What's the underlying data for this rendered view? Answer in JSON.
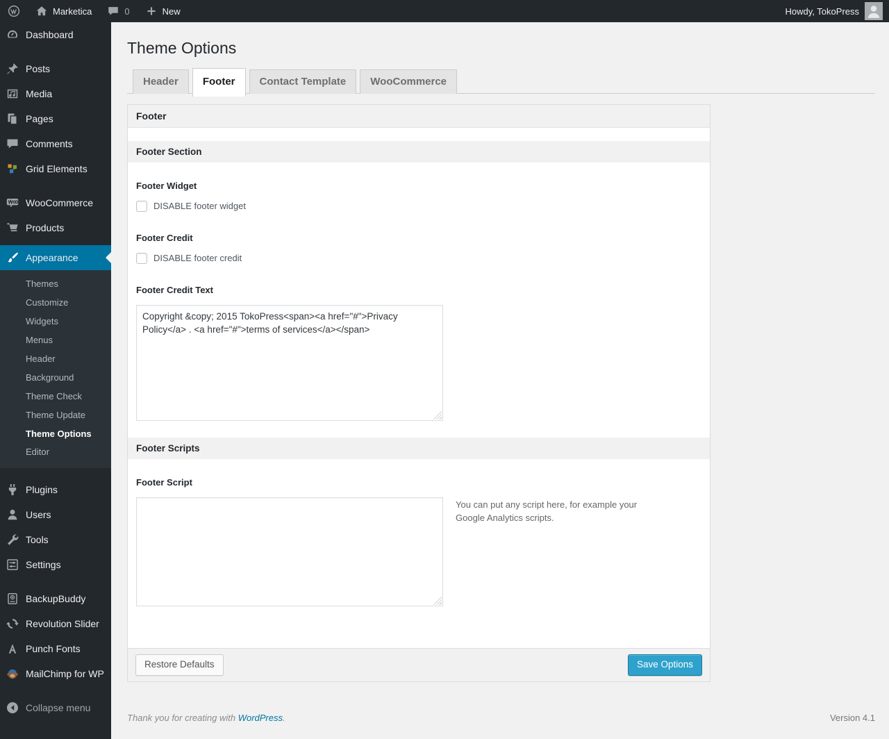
{
  "admin_bar": {
    "site_name": "Marketica",
    "comments_count": "0",
    "new_label": "New",
    "howdy": "Howdy, TokoPress"
  },
  "sidebar": {
    "dashboard": "Dashboard",
    "posts": "Posts",
    "media": "Media",
    "pages": "Pages",
    "comments": "Comments",
    "grid_elements": "Grid Elements",
    "woocommerce": "WooCommerce",
    "products": "Products",
    "appearance": "Appearance",
    "appearance_submenu": [
      "Themes",
      "Customize",
      "Widgets",
      "Menus",
      "Header",
      "Background",
      "Theme Check",
      "Theme Update",
      "Theme Options",
      "Editor"
    ],
    "plugins": "Plugins",
    "users": "Users",
    "tools": "Tools",
    "settings": "Settings",
    "backupbuddy": "BackupBuddy",
    "revolution_slider": "Revolution Slider",
    "punch_fonts": "Punch Fonts",
    "mailchimp": "MailChimp for WP",
    "collapse": "Collapse menu"
  },
  "page": {
    "title": "Theme Options"
  },
  "tabs": {
    "header": "Header",
    "footer": "Footer",
    "contact": "Contact Template",
    "woocommerce": "WooCommerce",
    "active_tab": "Footer"
  },
  "panel": {
    "title": "Footer",
    "footer_section": {
      "title": "Footer Section",
      "footer_widget_label": "Footer Widget",
      "footer_widget_checkbox_label": "DISABLE footer widget",
      "footer_widget_checked": false,
      "footer_credit_label": "Footer Credit",
      "footer_credit_checkbox_label": "DISABLE footer credit",
      "footer_credit_checked": false,
      "footer_credit_text_label": "Footer Credit Text",
      "footer_credit_text_value": "Copyright &copy; 2015 TokoPress<span><a href=\"#\">Privacy Policy</a> . <a href=\"#\">terms of services</a></span>"
    },
    "footer_scripts": {
      "title": "Footer Scripts",
      "footer_script_label": "Footer Script",
      "footer_script_value": "",
      "footer_script_help": "You can put any script here, for example your Google Analytics scripts."
    },
    "buttons": {
      "restore": "Restore Defaults",
      "save": "Save Options"
    }
  },
  "footer": {
    "thanks_prefix": "Thank you for creating with ",
    "thanks_link": "WordPress",
    "thanks_suffix": ".",
    "version": "Version 4.1"
  },
  "colors": {
    "menu_dark": "#23282d",
    "active_blue": "#0074a2",
    "button_blue": "#2ea2cc",
    "page_bg": "#f1f1f1"
  }
}
